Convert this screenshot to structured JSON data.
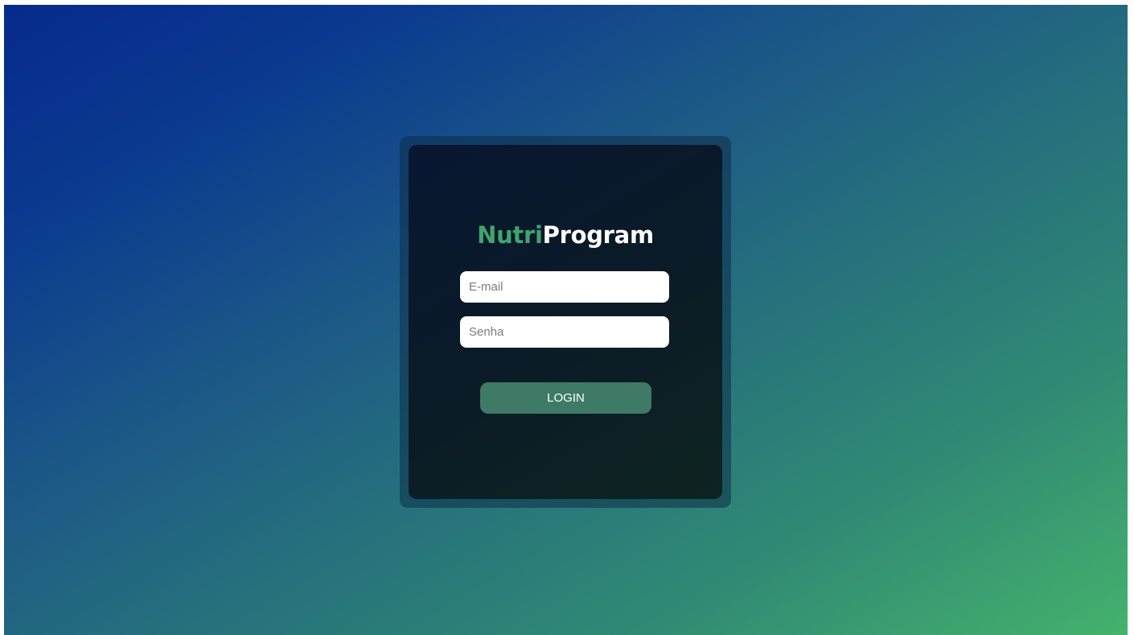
{
  "brand": {
    "part1": "Nutri",
    "part2": "Program",
    "accent_color": "#3fa56c"
  },
  "form": {
    "email_placeholder": "E-mail",
    "password_placeholder": "Senha",
    "login_label": "LOGIN",
    "button_color": "#3e7a66"
  },
  "theme": {
    "gradient_start": "#062a8c",
    "gradient_end": "#44b26c",
    "card_background": "#0b1a28"
  }
}
